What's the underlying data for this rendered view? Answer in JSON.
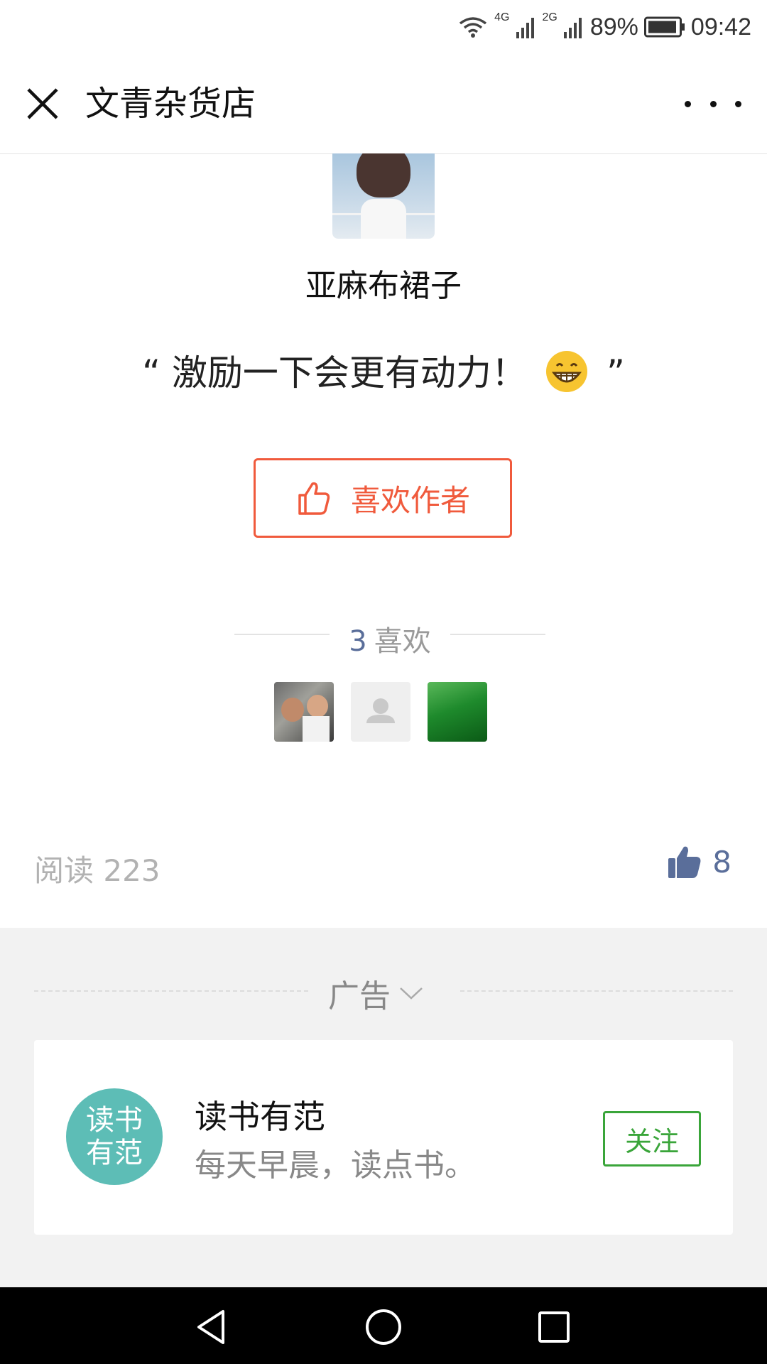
{
  "status_bar": {
    "network1": "4G",
    "network2": "2G",
    "battery": "89%",
    "time": "09:42"
  },
  "header": {
    "title": "文青杂货店"
  },
  "author": {
    "name": "亚麻布裙子",
    "quote": "“ 激励一下会更有动力！",
    "quote_end": "”"
  },
  "like_author_label": "喜欢作者",
  "likes": {
    "count": "3",
    "label": "喜欢"
  },
  "stats": {
    "read": "阅读 223",
    "likes": "8"
  },
  "ad": {
    "label": "广告",
    "logo_line1": "读书",
    "logo_line2": "有范",
    "name": "读书有范",
    "desc": "每天早晨，读点书。",
    "follow": "关注"
  },
  "colors": {
    "accent": "#f05a3c",
    "link": "#5a6e9a",
    "follow": "#3aa53a",
    "ad_logo": "#5dbdb6"
  }
}
